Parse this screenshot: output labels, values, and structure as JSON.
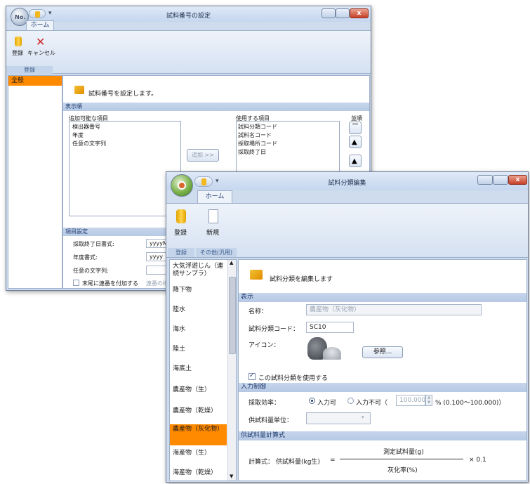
{
  "w1": {
    "title": "試料番号の設定",
    "orb_label": "No.",
    "tab": "ホーム",
    "buttons": {
      "register": "登録",
      "cancel": "キャンセル"
    },
    "group_label": "登録",
    "nav": [
      "全般"
    ],
    "info": "試料番号を設定します。",
    "section_display": "表示順",
    "available_label": "追加可能な項目",
    "available_items": [
      "検出器番号",
      "年度",
      "任意の文字列"
    ],
    "add_button": "追加 >>",
    "used_label": "使用する項目",
    "used_items": [
      "試料分類コード",
      "試料名コード",
      "採取場所コード",
      "採取終了日"
    ],
    "order_label": "並順",
    "section_item": "項目設定",
    "end_date_format_label": "採取終了日書式:",
    "end_date_format_value": "yyyyMM",
    "year_format_label": "年度書式:",
    "year_format_value": "yyyy",
    "any_string_label": "任意の文字列:",
    "serial_label": "末尾に連番を付加する",
    "serial_sub": "連番の桁"
  },
  "w2": {
    "title": "試料分類編集",
    "tab": "ホーム",
    "buttons": {
      "register": "登録",
      "new": "新規"
    },
    "group_register": "登録",
    "group_other": "その他(汎用)",
    "nav": [
      "大気浮遊じん（連続サンプラ）",
      "降下物",
      "陸水",
      "海水",
      "陸土",
      "海底土",
      "農産物（生）",
      "農産物（乾燥）",
      "農産物（灰化物）",
      "海産物（生）",
      "海産物（乾燥）"
    ],
    "selected_index": 8,
    "info": "試料分類を編集します",
    "section_display": "表示",
    "name_label": "名称：",
    "name_value": "農産物（灰化物）",
    "code_label": "試料分類コード：",
    "code_value": "SC10",
    "icon_label": "アイコン：",
    "browse_button": "参照...",
    "use_label": "この試料分類を使用する",
    "section_input": "入力制御",
    "rate_label": "採取効率：",
    "radio_yes": "入力可",
    "radio_no": "入力不可（",
    "rate_value": "100.000",
    "rate_range": "% (0.100～100.000)）",
    "unit_label": "供試料量単位：",
    "section_calc": "供試料量計算式",
    "formula_label": "計算式：",
    "formula_lhs": "供試料量(kg生)",
    "formula_eq": "=",
    "numerator": "測定試料量(g)",
    "denominator": "灰化率(%)",
    "multiplier": "× 0.1"
  },
  "colors": {
    "selected": "#ff8a00",
    "accent": "#1e3a6e"
  }
}
